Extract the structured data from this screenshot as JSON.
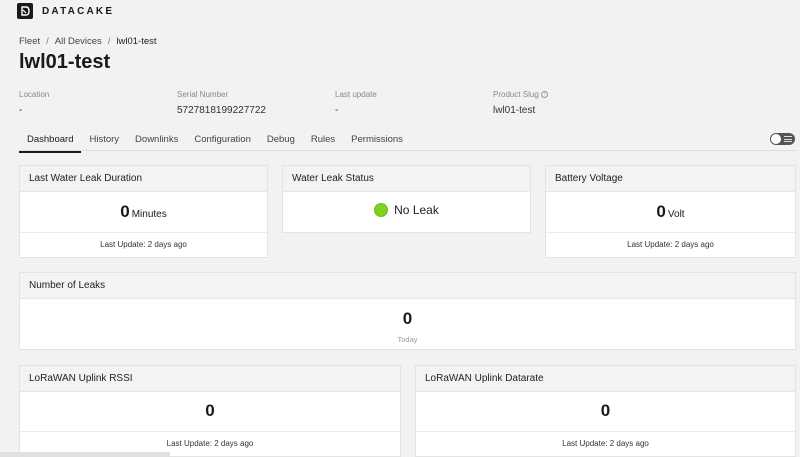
{
  "brand": {
    "name": "DATACAKE"
  },
  "breadcrumb": [
    "Fleet",
    "All Devices",
    "lwl01-test"
  ],
  "device": {
    "title": "lwl01-test",
    "meta": [
      {
        "label": "Location",
        "value": "-"
      },
      {
        "label": "Serial Number",
        "value": "5727818199227722"
      },
      {
        "label": "Last update",
        "value": "-"
      },
      {
        "label": "Product Slug",
        "value": "lwl01-test"
      }
    ]
  },
  "tabs": [
    "Dashboard",
    "History",
    "Downlinks",
    "Configuration",
    "Debug",
    "Rules",
    "Permissions"
  ],
  "active_tab": "Dashboard",
  "widgets": {
    "leak_duration": {
      "title": "Last Water Leak Duration",
      "value": "0",
      "unit": "Minutes",
      "footer": "Last Update: 2 days ago"
    },
    "leak_status": {
      "title": "Water Leak Status",
      "status": "No Leak",
      "status_color": "#7ed321"
    },
    "battery": {
      "title": "Battery Voltage",
      "value": "0",
      "unit": "Volt",
      "footer": "Last Update: 2 days ago"
    },
    "num_leaks": {
      "title": "Number of Leaks",
      "value": "0",
      "sub": "Today"
    },
    "rssi": {
      "title": "LoRaWAN Uplink RSSI",
      "value": "0",
      "footer": "Last Update: 2 days ago"
    },
    "datarate": {
      "title": "LoRaWAN Uplink Datarate",
      "value": "0",
      "footer": "Last Update: 2 days ago"
    }
  }
}
